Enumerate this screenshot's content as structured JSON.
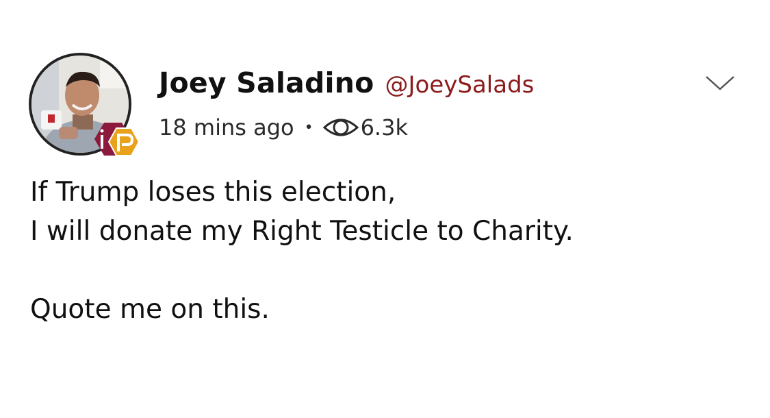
{
  "post": {
    "author": {
      "display_name": "Joey Saladino",
      "handle": "@JoeySalads",
      "avatar_icon": "avatar-photo",
      "badge_icon": "parler-badge-icon"
    },
    "meta": {
      "time": "18 mins ago",
      "separator": "•",
      "views_icon": "eye-icon",
      "views": "6.3k"
    },
    "menu_icon": "chevron-down-icon",
    "text": {
      "line1": "If Trump loses this election,",
      "line2": "I will donate my Right Testicle to Charity.",
      "line3": "Quote me on this."
    }
  },
  "colors": {
    "handle": "#8b1c1c",
    "badge_outer": "#8b1a3c",
    "badge_inner": "#e8a21c"
  }
}
